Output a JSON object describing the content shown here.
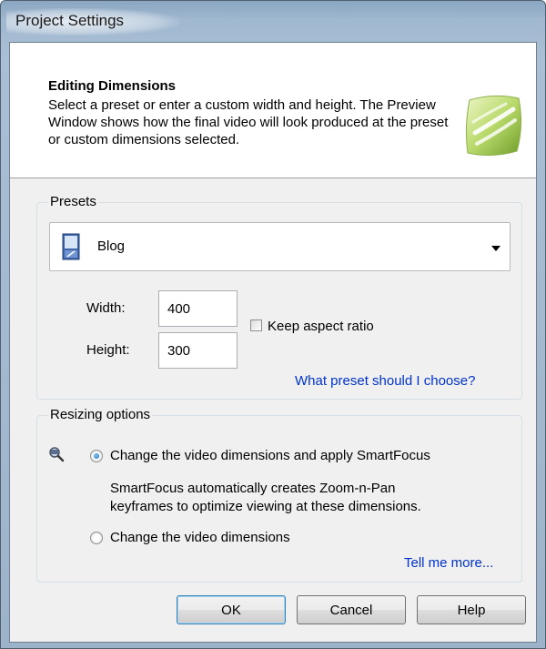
{
  "window": {
    "title": "Project Settings"
  },
  "header": {
    "title": "Editing Dimensions",
    "description": "Select a preset or enter a custom width and height. The Preview Window shows how the final video will look produced at the preset or custom dimensions selected.",
    "logo_icon": "green-brush-logo-icon"
  },
  "presets": {
    "group_label": "Presets",
    "selected": "Blog",
    "selected_icon": "blog-preset-icon",
    "width_label": "Width:",
    "width_value": "400",
    "height_label": "Height:",
    "height_value": "300",
    "keep_aspect_label": "Keep aspect ratio",
    "keep_aspect_checked": false,
    "help_link": "What preset should I choose?"
  },
  "resizing": {
    "group_label": "Resizing options",
    "option_icon": "smartfocus-magnifier-icon",
    "option1_label": "Change the video dimensions and apply SmartFocus",
    "option1_desc_line1": "SmartFocus automatically creates Zoom-n-Pan",
    "option1_desc_line2": "keyframes to optimize viewing at these dimensions.",
    "option1_selected": true,
    "option2_label": "Change the video dimensions",
    "option2_selected": false,
    "more_link": "Tell me more..."
  },
  "buttons": {
    "ok": "OK",
    "cancel": "Cancel",
    "help": "Help"
  }
}
